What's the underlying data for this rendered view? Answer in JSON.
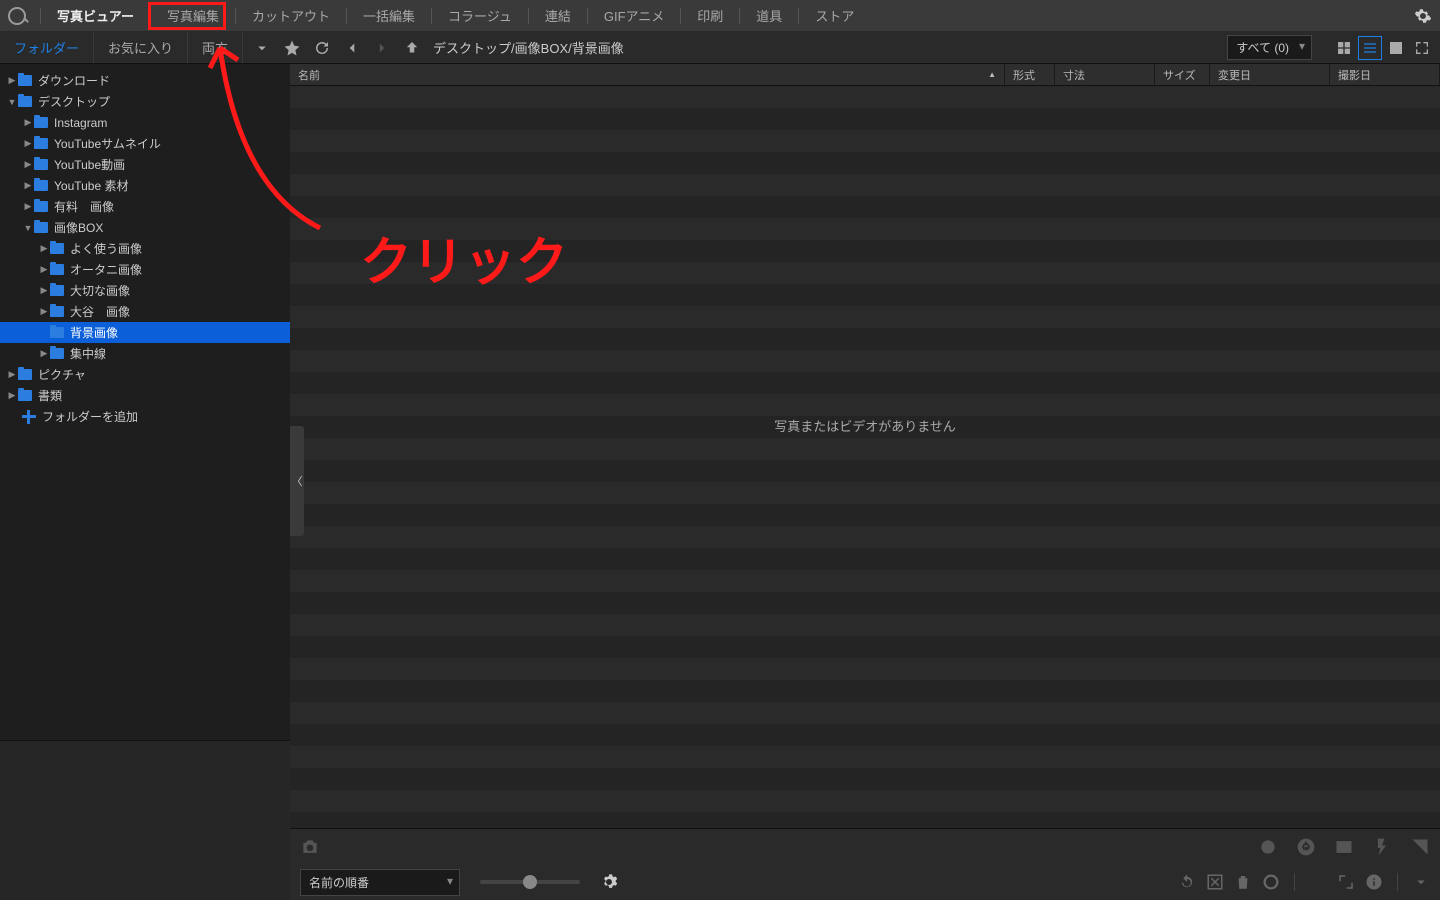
{
  "topmenu": {
    "items": [
      "写真ビュアー",
      "写真編集",
      "カットアウト",
      "一括編集",
      "コラージュ",
      "連結",
      "GIFアニメ",
      "印刷",
      "道具",
      "ストア"
    ],
    "active_index": 0,
    "highlight_index": 1
  },
  "subnav": {
    "tabs": [
      "フォルダー",
      "お気に入り",
      "両方"
    ],
    "selected": 0,
    "breadcrumb": "デスクトップ/画像BOX/背景画像",
    "filter_label": "すべて (0)"
  },
  "tree": [
    {
      "depth": 0,
      "tw": "▶",
      "label": "ダウンロード"
    },
    {
      "depth": 0,
      "tw": "▼",
      "label": "デスクトップ"
    },
    {
      "depth": 1,
      "tw": "▶",
      "label": "Instagram"
    },
    {
      "depth": 1,
      "tw": "▶",
      "label": "YouTubeサムネイル"
    },
    {
      "depth": 1,
      "tw": "▶",
      "label": "YouTube動画"
    },
    {
      "depth": 1,
      "tw": "▶",
      "label": "YouTube 素材"
    },
    {
      "depth": 1,
      "tw": "▶",
      "label": "有料　画像"
    },
    {
      "depth": 1,
      "tw": "▼",
      "label": "画像BOX"
    },
    {
      "depth": 2,
      "tw": "▶",
      "label": "よく使う画像"
    },
    {
      "depth": 2,
      "tw": "▶",
      "label": "オータニ画像"
    },
    {
      "depth": 2,
      "tw": "▶",
      "label": "大切な画像"
    },
    {
      "depth": 2,
      "tw": "▶",
      "label": "大谷　画像"
    },
    {
      "depth": 2,
      "tw": "",
      "label": "背景画像",
      "sel": true
    },
    {
      "depth": 2,
      "tw": "▶",
      "label": "集中線"
    },
    {
      "depth": 0,
      "tw": "▶",
      "label": "ピクチャ"
    },
    {
      "depth": 0,
      "tw": "▶",
      "label": "書類"
    }
  ],
  "add_folder_label": "フォルダーを追加",
  "columns": {
    "name": "名前",
    "format": "形式",
    "dim": "寸法",
    "size": "サイズ",
    "modified": "変更日",
    "shot": "撮影日"
  },
  "empty_message": "写真またはビデオがありません",
  "bottom": {
    "sort_label": "名前の順番"
  },
  "annotation": {
    "text": "クリック"
  }
}
